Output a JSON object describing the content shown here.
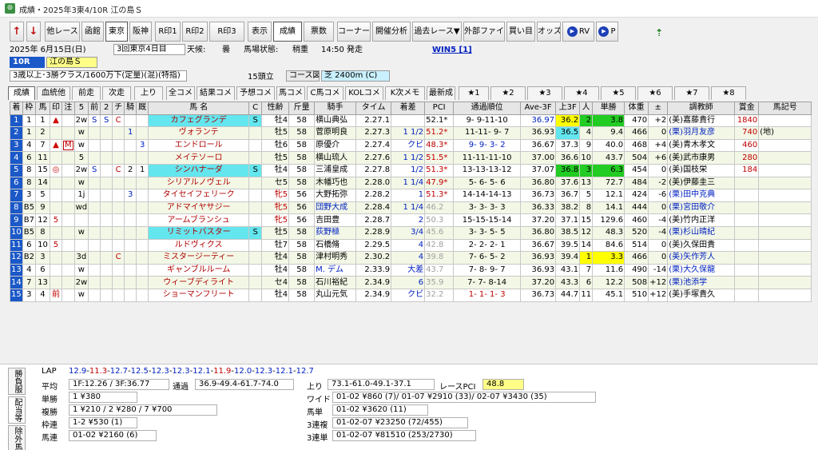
{
  "window": {
    "title": "成績・2025年3東4/10R 江の島Ｓ"
  },
  "toolbar": {
    "buttons": [
      "他レース",
      "函館",
      "東京",
      "阪神",
      "R印1",
      "R印2",
      "R印3",
      "表示",
      "成績",
      "票数",
      "コーナー順",
      "開催分析",
      "過去レース▼",
      "外部ファイル",
      "買い目",
      "オッズ",
      "RV",
      "P"
    ],
    "selected": "成績"
  },
  "race": {
    "date": "2025年 6月15日(日)",
    "kaisai": "3回東京4日目",
    "weather_label": "天候:",
    "weather": "曇",
    "track_label": "馬場状態:",
    "track": "稍重",
    "time": "14:50 発走",
    "win5": "WIN5 [1]",
    "race_no": "10R",
    "race_name": "江の島Ｓ",
    "conditions": "3歳以上･3勝クラス/1600万下(定量)(混)(特指)",
    "runners": "15頭立",
    "course_label": "コース図",
    "course": "芝 2400m (C)"
  },
  "tabs": [
    "成績",
    "血統他",
    "前走",
    "次走",
    "上り",
    "全コメ",
    "結果コメ",
    "予想コメ",
    "馬コメ",
    "C馬コメ",
    "KOLコメ",
    "K次メモ",
    "最新成",
    "★1",
    "★2",
    "★3",
    "★4",
    "★5",
    "★6",
    "★7",
    "★8"
  ],
  "table": {
    "headers": [
      "着",
      "枠",
      "馬",
      "印",
      "注",
      "5",
      "前",
      "2",
      "チ",
      "騎",
      "厩",
      "馬 名",
      "C",
      "性齢",
      "斤量",
      "騎手",
      "タイム",
      "着差",
      "PCI",
      "通過順位",
      "Ave-3F",
      "上3F",
      "人",
      "単勝",
      "体重",
      "±",
      "調教師",
      "賞金",
      "馬記号"
    ],
    "rows": [
      {
        "cells": [
          "1",
          "1",
          "1",
          "▲",
          "",
          "2w",
          "S",
          "S",
          "C",
          "",
          "",
          "カフェグランデ",
          "S",
          "牡4",
          "58",
          "横山典弘",
          "2.27.1",
          "",
          "52.1*",
          "9- 9-11-10",
          "36.97",
          "36.2",
          "2",
          "3.8",
          "470",
          "+2",
          "(美)嘉藤貴行",
          "1840",
          ""
        ],
        "markers": {
          "3": "tri",
          "6": "blue",
          "7": "blue",
          "8": "red",
          "11": "aqua",
          "12": "aqua",
          "17": "red",
          "20": "blue",
          "21": "yel",
          "22": "grn",
          "23": "grn",
          "27": "red"
        }
      },
      {
        "cells": [
          "2",
          "1",
          "2",
          "",
          "",
          "w",
          "",
          "",
          "",
          "1",
          "",
          "ヴォランテ",
          "",
          "牡5",
          "58",
          "菅原明良",
          "2.27.3",
          "1 1/2",
          "51.2*",
          "11-11- 9- 7",
          "36.93",
          "36.5",
          "4",
          "9.4",
          "466",
          "0",
          "(栗)羽月友彦",
          "740",
          "(地)"
        ],
        "markers": {
          "9": "blue",
          "17": "blue",
          "18": "red",
          "21": "aqua",
          "26": "blue",
          "27": "red"
        }
      },
      {
        "cells": [
          "3",
          "4",
          "7",
          "▲",
          "M",
          "w",
          "",
          "",
          "",
          "",
          "3",
          "エンドロール",
          "",
          "牡6",
          "58",
          "原優介",
          "2.27.4",
          "クビ",
          "48.3*",
          "9- 9- 3- 2",
          "36.67",
          "37.3",
          "9",
          "40.0",
          "468",
          "+4",
          "(美)青木孝文",
          "460",
          ""
        ],
        "markers": {
          "3": "tri",
          "4": "mbox",
          "10": "blue",
          "17": "blue",
          "18": "red",
          "19": "blue",
          "27": "red"
        }
      },
      {
        "cells": [
          "4",
          "6",
          "11",
          "",
          "",
          "5",
          "",
          "",
          "",
          "",
          "",
          "メイテソーロ",
          "",
          "牡5",
          "58",
          "横山琉人",
          "2.27.6",
          "1 1/2",
          "51.5*",
          "11-11-11-10",
          "37.00",
          "36.6",
          "10",
          "43.7",
          "504",
          "+6",
          "(美)武市康男",
          "280",
          ""
        ],
        "markers": {
          "17": "blue",
          "18": "red",
          "27": "red"
        }
      },
      {
        "cells": [
          "5",
          "8",
          "15",
          "◎",
          "",
          "2w",
          "S",
          "",
          "C",
          "2",
          "1",
          "シンハナーダ",
          "S",
          "牡4",
          "58",
          "三浦皇成",
          "2.27.8",
          "1/2",
          "51.3*",
          "13-13-13-12",
          "37.07",
          "36.8",
          "3",
          "6.3",
          "454",
          "0",
          "(美)国枝栄",
          "184",
          ""
        ],
        "markers": {
          "3": "ring",
          "6": "blue",
          "8": "red",
          "11": "aqua",
          "12": "aqua",
          "17": "blue",
          "18": "red",
          "21": "grn",
          "22": "grn",
          "23": "grn",
          "27": "red"
        }
      },
      {
        "cells": [
          "6",
          "8",
          "14",
          "",
          "",
          "w",
          "",
          "",
          "",
          "",
          "",
          "シリアルノヴェル",
          "",
          "セ5",
          "58",
          "木幡巧也",
          "2.28.0",
          "1 1/4",
          "47.9*",
          "5- 6- 5- 6",
          "36.80",
          "37.6",
          "13",
          "72.7",
          "484",
          "-2",
          "(美)伊藤圭三",
          "",
          ""
        ],
        "markers": {
          "17": "blue",
          "18": "red"
        }
      },
      {
        "cells": [
          "7",
          "3",
          "5",
          "",
          "",
          "1j",
          "",
          "",
          "",
          "3",
          "",
          "タイセイフェリーク",
          "",
          "牝5",
          "56",
          "大野拓弥",
          "2.28.2",
          "1",
          "51.3*",
          "14-14-14-13",
          "36.73",
          "36.7",
          "5",
          "12.1",
          "424",
          "-6",
          "(栗)田中克典",
          "",
          ""
        ],
        "markers": {
          "9": "blue",
          "13": "red",
          "17": "blue",
          "18": "red",
          "26": "blue"
        }
      },
      {
        "cells": [
          "8",
          "B5",
          "9",
          "",
          "",
          "wd",
          "",
          "",
          "",
          "",
          "",
          "アドマイヤサジー",
          "",
          "牝5",
          "56",
          "団野大成",
          "2.28.4",
          "1 1/4",
          "46.2",
          "3- 3- 3- 3",
          "36.33",
          "38.2",
          "8",
          "14.1",
          "444",
          "0",
          "(栗)宮田敬介",
          "",
          ""
        ],
        "markers": {
          "13": "red",
          "15": "blue",
          "17": "blue",
          "18": "gray",
          "26": "blue"
        }
      },
      {
        "cells": [
          "9",
          "B7",
          "12",
          "5",
          "",
          "",
          "",
          "",
          "",
          "",
          "",
          "アームブランシュ",
          "",
          "牝5",
          "56",
          "吉田豊",
          "2.28.7",
          "2",
          "50.3",
          "15-15-15-14",
          "37.20",
          "37.1",
          "15",
          "129.6",
          "460",
          "-4",
          "(美)竹内正洋",
          "",
          ""
        ],
        "markers": {
          "3": "red",
          "13": "red",
          "17": "blue",
          "18": "gray"
        }
      },
      {
        "cells": [
          "10",
          "B5",
          "8",
          "",
          "",
          "w",
          "",
          "",
          "",
          "",
          "",
          "リミットバスター",
          "S",
          "牡5",
          "58",
          "荻野極",
          "2.28.9",
          "3/4",
          "45.6",
          "3- 3- 5- 5",
          "36.80",
          "38.5",
          "12",
          "48.3",
          "520",
          "-4",
          "(栗)杉山晴紀",
          "",
          ""
        ],
        "markers": {
          "11": "aqua",
          "12": "aqua",
          "15": "blue",
          "17": "blue",
          "18": "gray",
          "26": "blue"
        }
      },
      {
        "cells": [
          "11",
          "6",
          "10",
          "5",
          "",
          "",
          "",
          "",
          "",
          "",
          "",
          "ルドヴィクス",
          "",
          "牡7",
          "58",
          "石橋脩",
          "2.29.5",
          "4",
          "42.8",
          "2- 2- 2- 1",
          "36.67",
          "39.5",
          "14",
          "84.6",
          "514",
          "0",
          "(美)久保田貴",
          "",
          ""
        ],
        "markers": {
          "3": "red",
          "17": "blue",
          "18": "gray"
        }
      },
      {
        "cells": [
          "12",
          "B2",
          "3",
          "",
          "",
          "3d",
          "",
          "",
          "C",
          "",
          "",
          "ミスタージーティー",
          "",
          "牡4",
          "58",
          "津村明秀",
          "2.30.2",
          "4",
          "39.8",
          "7- 6- 5- 2",
          "36.93",
          "39.4",
          "1",
          "3.3",
          "466",
          "0",
          "(美)矢作芳人",
          "",
          ""
        ],
        "markers": {
          "8": "red",
          "17": "blue",
          "18": "gray",
          "22": "yel",
          "23": "yel",
          "26": "blue"
        }
      },
      {
        "cells": [
          "13",
          "4",
          "6",
          "",
          "",
          "w",
          "",
          "",
          "",
          "",
          "",
          "ギャンブルルーム",
          "",
          "牡4",
          "58",
          "M. デム",
          "2.33.9",
          "大差",
          "43.7",
          "7- 8- 9- 7",
          "36.93",
          "43.1",
          "7",
          "11.6",
          "490",
          "-14",
          "(栗)大久保龍",
          "",
          ""
        ],
        "markers": {
          "15": "blue",
          "17": "blue",
          "18": "gray",
          "26": "blue"
        }
      },
      {
        "cells": [
          "14",
          "7",
          "13",
          "",
          "",
          "2w",
          "",
          "",
          "",
          "",
          "",
          "ウィーブディライト",
          "",
          "セ4",
          "58",
          "石川裕紀",
          "2.34.9",
          "6",
          "35.9",
          "7- 7- 8-14",
          "37.20",
          "43.3",
          "6",
          "12.2",
          "508",
          "+12",
          "(栗)池添学",
          "",
          ""
        ],
        "markers": {
          "17": "blue",
          "18": "gray",
          "26": "blue"
        }
      },
      {
        "cells": [
          "15",
          "3",
          "4",
          "前",
          "",
          "w",
          "",
          "",
          "",
          "",
          "",
          "ショーマンフリート",
          "",
          "牡4",
          "58",
          "丸山元気",
          "2.34.9",
          "クビ",
          "32.2",
          "1- 1- 1- 3",
          "36.73",
          "44.7",
          "11",
          "45.1",
          "510",
          "+12",
          "(美)手塚貴久",
          "",
          ""
        ],
        "markers": {
          "3": "red",
          "17": "blue",
          "18": "gray",
          "19": "red"
        }
      }
    ]
  },
  "side_tabs": [
    "勝負服",
    "配当等",
    "除外馬"
  ],
  "results": {
    "lap_label": "LAP",
    "lap": [
      "12.9",
      "11.3",
      "12.7",
      "12.5",
      "12.3",
      "12.3",
      "12.1",
      "11.9",
      "12.0",
      "12.3",
      "12.1",
      "12.7"
    ],
    "avg_label": "平均",
    "avg": "1F:12.26 / 3F:36.77",
    "tsuka_label": "通過",
    "tsuka": "36.9-49.4-61.7-74.0",
    "agari_label": "上り",
    "agari": "73.1-61.0-49.1-37.1",
    "pci_label": "レースPCI",
    "pci": "48.8",
    "pay": {
      "tansho_label": "単勝",
      "tansho": "1 ¥380",
      "fukusho_label": "複勝",
      "fukusho": "1 ¥210 / 2 ¥280 / 7 ¥700",
      "wakuren_label": "枠連",
      "wakuren": "1-2 ¥530 (1)",
      "umaren_label": "馬連",
      "umaren": "01-02 ¥2160 (6)",
      "wide_label": "ワイド",
      "wide": "01-02 ¥860 (7)/ 01-07 ¥2910 (33)/ 02-07 ¥3430 (35)",
      "umatan_label": "馬単",
      "umatan": "01-02 ¥3620 (11)",
      "sanrenpuku_label": "3連複",
      "sanrenpuku": "01-02-07 ¥23250 (72/455)",
      "sanrentan_label": "3連単",
      "sanrentan": "01-02-07 ¥81510 (253/2730)"
    }
  },
  "colors": {
    "num_bg": "#1b58c8",
    "aqua": "#63e6ee",
    "yellow": "#ffff00",
    "green": "#22cc22"
  }
}
